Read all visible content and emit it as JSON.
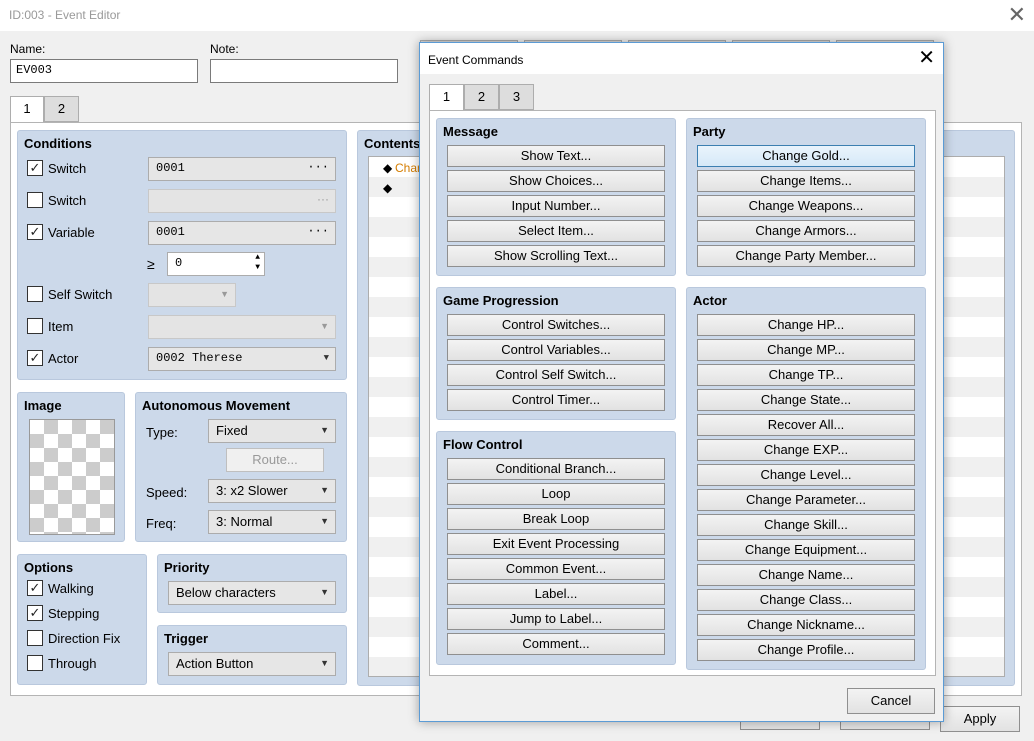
{
  "window": {
    "title": "ID:003 - Event Editor",
    "close": "✕"
  },
  "name_label": "Name:",
  "name_value": "EV003",
  "note_label": "Note:",
  "note_value": "",
  "pages": [
    "1",
    "2"
  ],
  "conditions": {
    "title": "Conditions",
    "rows": [
      {
        "label": "Switch",
        "checked": true,
        "value": "0001"
      },
      {
        "label": "Switch",
        "checked": false,
        "value": ""
      },
      {
        "label": "Variable",
        "checked": true,
        "value": "0001"
      },
      {
        "label": "Self Switch",
        "checked": false,
        "value": ""
      },
      {
        "label": "Item",
        "checked": false,
        "value": ""
      },
      {
        "label": "Actor",
        "checked": true,
        "value": "0002 Therese"
      }
    ],
    "ge_symbol": "≥",
    "variable_min": "0"
  },
  "image": {
    "title": "Image"
  },
  "movement": {
    "title": "Autonomous Movement",
    "type_label": "Type:",
    "type_value": "Fixed",
    "route_button": "Route...",
    "speed_label": "Speed:",
    "speed_value": "3: x2 Slower",
    "freq_label": "Freq:",
    "freq_value": "3: Normal"
  },
  "options": {
    "title": "Options",
    "items": [
      {
        "label": "Walking",
        "checked": true
      },
      {
        "label": "Stepping",
        "checked": true
      },
      {
        "label": "Direction Fix",
        "checked": false
      },
      {
        "label": "Through",
        "checked": false
      }
    ]
  },
  "priority": {
    "title": "Priority",
    "value": "Below characters"
  },
  "trigger": {
    "title": "Trigger",
    "value": "Action Button"
  },
  "contents": {
    "title": "Contents",
    "first_line": "Chan",
    "marker": "◆"
  },
  "main_buttons": {
    "apply": "Apply"
  },
  "dialog": {
    "title": "Event Commands",
    "close": "✕",
    "tabs": [
      "1",
      "2",
      "3"
    ],
    "message": {
      "title": "Message",
      "commands": [
        "Show Text...",
        "Show Choices...",
        "Input Number...",
        "Select Item...",
        "Show Scrolling Text..."
      ]
    },
    "game_progression": {
      "title": "Game Progression",
      "commands": [
        "Control Switches...",
        "Control Variables...",
        "Control Self Switch...",
        "Control Timer..."
      ]
    },
    "flow_control": {
      "title": "Flow Control",
      "commands": [
        "Conditional Branch...",
        "Loop",
        "Break Loop",
        "Exit Event Processing",
        "Common Event...",
        "Label...",
        "Jump to Label...",
        "Comment..."
      ]
    },
    "party": {
      "title": "Party",
      "commands": [
        "Change Gold...",
        "Change Items...",
        "Change Weapons...",
        "Change Armors...",
        "Change Party Member..."
      ]
    },
    "actor": {
      "title": "Actor",
      "commands": [
        "Change HP...",
        "Change MP...",
        "Change TP...",
        "Change State...",
        "Recover All...",
        "Change EXP...",
        "Change Level...",
        "Change Parameter...",
        "Change Skill...",
        "Change Equipment...",
        "Change Name...",
        "Change Class...",
        "Change Nickname...",
        "Change Profile..."
      ]
    },
    "cancel": "Cancel"
  }
}
